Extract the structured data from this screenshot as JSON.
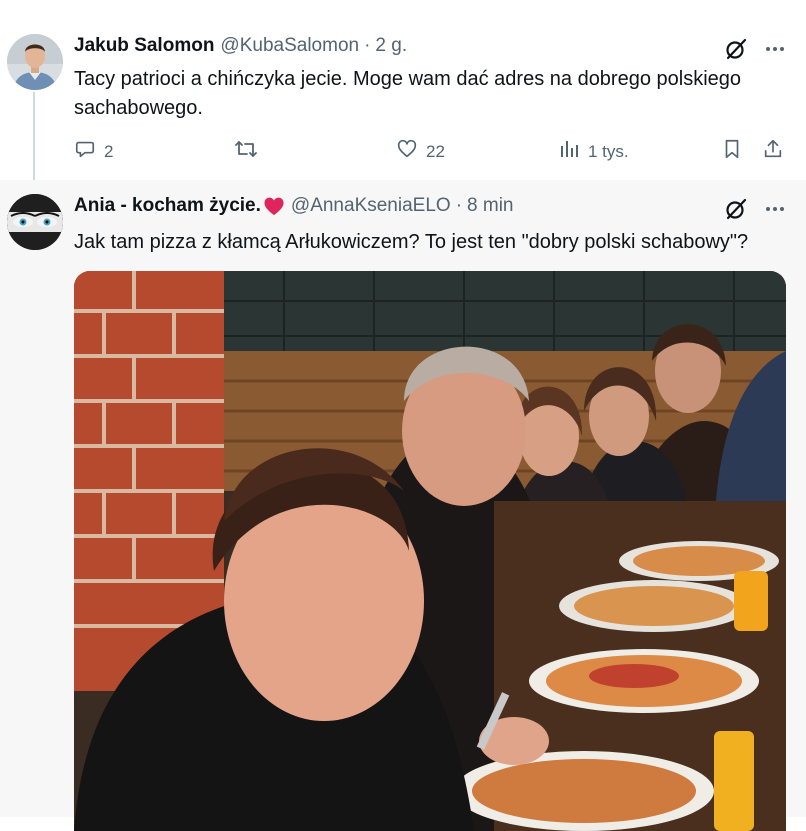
{
  "tweets": [
    {
      "name": "Jakub Salomon",
      "handle": "@KubaSalomon",
      "separator": "·",
      "time": "2 g.",
      "text": "Tacy patrioci a chińczyka jecie. Moge wam dać adres na dobrego polskiego sachabowego.",
      "replies": "2",
      "reposts": "",
      "likes": "22",
      "views": "1 tys.",
      "icons": [
        "grok-icon",
        "more-icon",
        "reply-icon",
        "repost-icon",
        "like-icon",
        "views-icon",
        "bookmark-icon",
        "share-icon"
      ]
    },
    {
      "name": "Ania - kocham życie.",
      "handle": "@AnnaKseniaELO",
      "separator": "·",
      "time": "8 min",
      "text": "Jak tam pizza z kłamcą Arłukowiczem? To jest ten \"dobry polski schabowy\"?",
      "icons": [
        "heart-emoji-icon",
        "grok-icon",
        "more-icon"
      ],
      "media": "photo"
    }
  ],
  "colors": {
    "text": "#0f1419",
    "secondary": "#536471",
    "heart": "#e0245e",
    "thread_line": "#cfd9de",
    "reply_background": "#f7f7f7"
  }
}
